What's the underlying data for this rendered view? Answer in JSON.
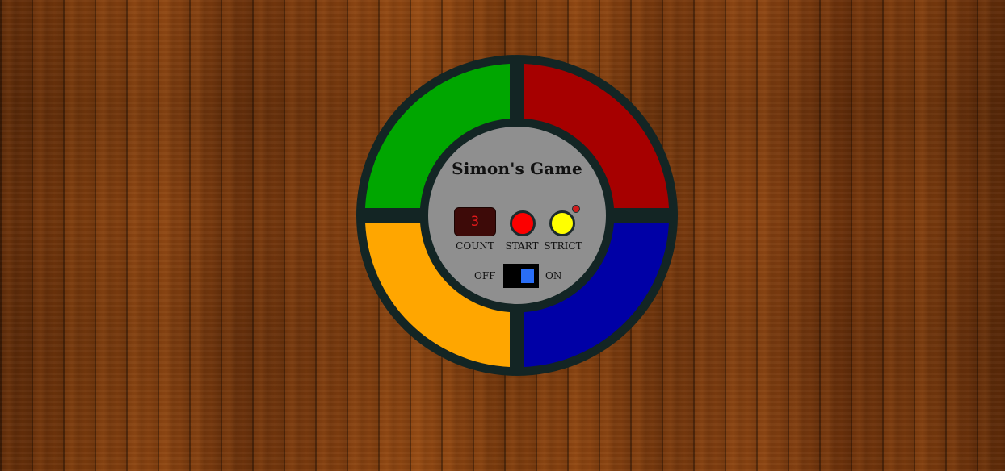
{
  "game": {
    "title": "Simon's Game",
    "count_display": "3",
    "controls": {
      "count_label": "COUNT",
      "start_label": "START",
      "strict_label": "STRICT"
    },
    "power": {
      "off_label": "OFF",
      "on_label": "ON",
      "state": "on"
    }
  },
  "colors": {
    "green": "#00a600",
    "red": "#a60000",
    "yellow": "#ffa600",
    "blue": "#0000a6",
    "frame": "#132524",
    "center": "#8f8f8f",
    "start_button": "#fc0000",
    "strict_button": "#ffff00",
    "strict_led": "#d01d1d",
    "switch_knob": "#2a6ef6"
  }
}
